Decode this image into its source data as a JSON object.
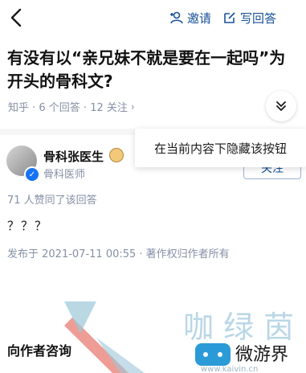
{
  "top_bar": {
    "invite_label": "邀请",
    "write_answer_label": "写回答"
  },
  "question": {
    "title": "有没有以“亲兄妹不就是要在一起吗”为开头的骨科文?",
    "meta": "知乎 · 6 个回答 · 12 关注"
  },
  "tooltip": {
    "text": "在当前内容下隐藏该按钮"
  },
  "follow_label": "关注",
  "author": {
    "name": "骨科张医生",
    "title": "骨科医师"
  },
  "answer": {
    "agree_count": "71 人赞同了该回答",
    "content": "？？？",
    "post_meta": "发布于 2021-07-11 00:55 · 著作权归作者所有"
  },
  "consult_label": "向作者咨询",
  "watermark": {
    "cn": "咖 绿 茵",
    "brand": "微游界",
    "url": "www.kaivin.cn"
  },
  "colors": {
    "link_blue": "#175199",
    "meta_gray": "#8590a6",
    "verify_blue": "#1772f6"
  }
}
